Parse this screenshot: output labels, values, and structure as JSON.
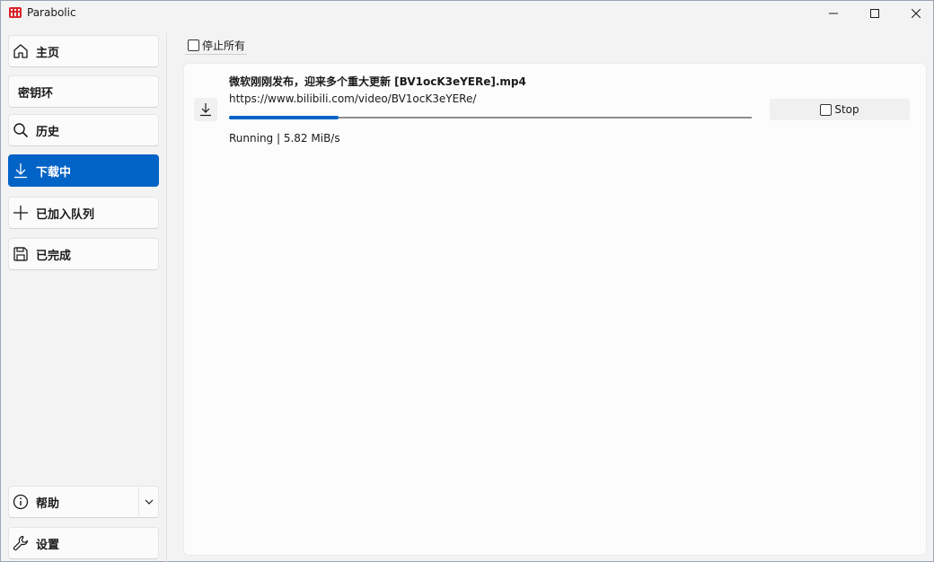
{
  "window": {
    "title": "Parabolic"
  },
  "sidebar": {
    "items": [
      {
        "label": "主页",
        "icon": "home-icon"
      },
      {
        "label": "密钥环",
        "icon": ""
      },
      {
        "label": "历史",
        "icon": "search-icon"
      },
      {
        "label": "下载中",
        "icon": "download-icon",
        "active": true
      },
      {
        "label": "已加入队列",
        "icon": "plus-icon"
      },
      {
        "label": "已完成",
        "icon": "save-icon"
      }
    ],
    "bottom": [
      {
        "label": "帮助",
        "icon": "info-icon"
      },
      {
        "label": "设置",
        "icon": "wrench-icon"
      }
    ]
  },
  "toolbar": {
    "stop_all_label": "停止所有",
    "stop_all_checked": false
  },
  "downloads": [
    {
      "title": "微软刚刚发布，迎来多个重大更新 [BV1ocK3eYERe].mp4",
      "url": "https://www.bilibili.com/video/BV1ocK3eYERe/",
      "progress": 0.21,
      "status": "Running | 5.82 MiB/s",
      "stop_label": "Stop"
    }
  ],
  "colors": {
    "accent": "#0263c6",
    "background": "#f3f3f3",
    "panel": "#fcfcfc"
  }
}
